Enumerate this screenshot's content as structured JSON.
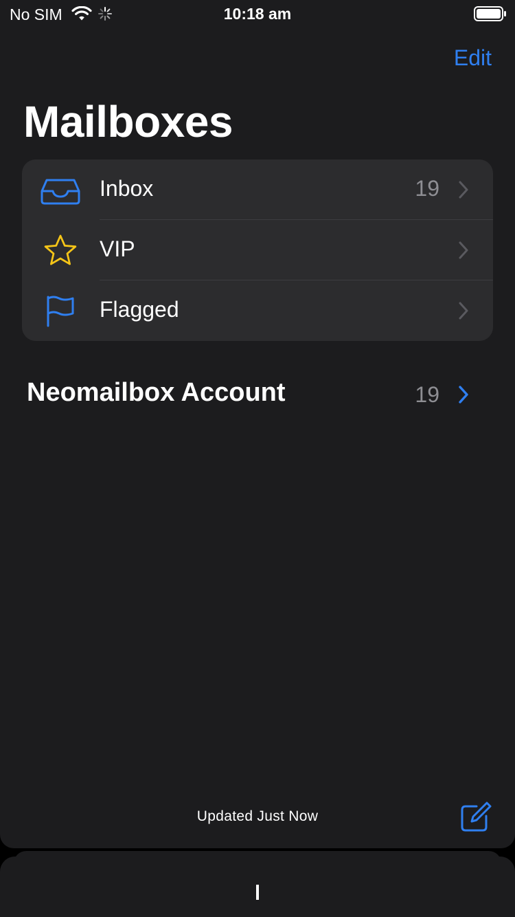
{
  "status_bar": {
    "carrier": "No SIM",
    "time": "10:18 am"
  },
  "nav": {
    "edit_label": "Edit",
    "title": "Mailboxes"
  },
  "mailboxes": [
    {
      "label": "Inbox",
      "count": "19",
      "icon": "inbox-tray-icon"
    },
    {
      "label": "VIP",
      "count": "",
      "icon": "star-icon"
    },
    {
      "label": "Flagged",
      "count": "",
      "icon": "flag-icon"
    }
  ],
  "account": {
    "label": "Neomailbox Account",
    "count": "19"
  },
  "toolbar": {
    "status": "Updated Just Now",
    "compose_icon": "compose-icon"
  },
  "colors": {
    "accent": "#2f7ff0",
    "vip_star": "#f5c518",
    "background": "#1c1c1e",
    "group": "#2c2c2e",
    "secondary_text": "#8e8e93"
  }
}
